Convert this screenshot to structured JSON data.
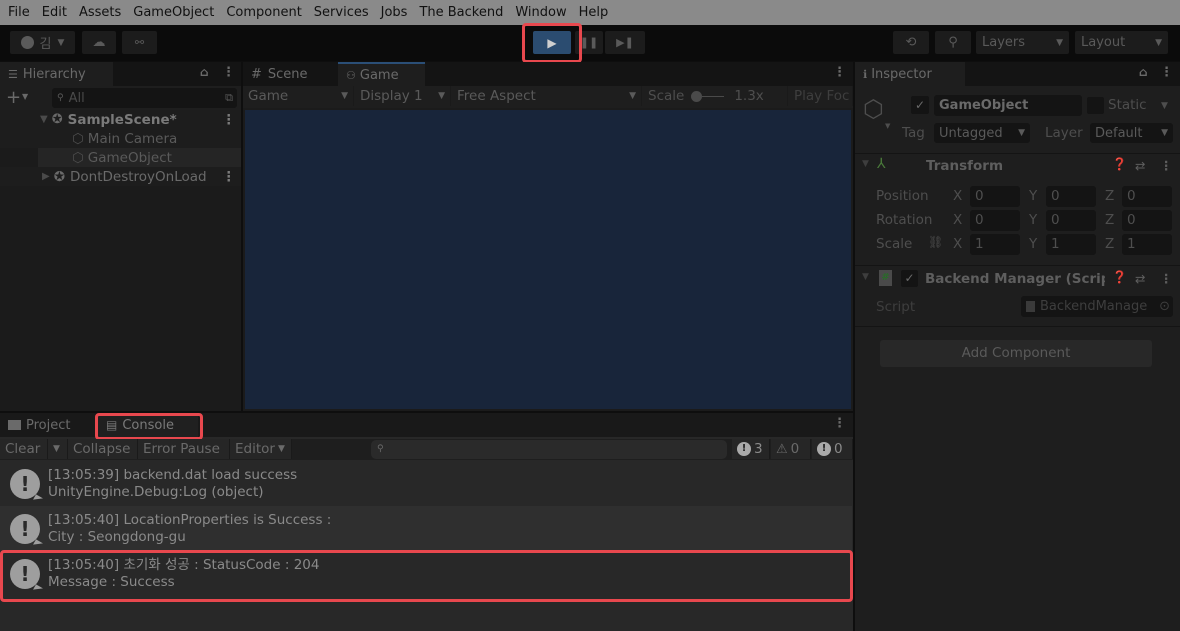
{
  "menubar": {
    "items": [
      "File",
      "Edit",
      "Assets",
      "GameObject",
      "Component",
      "Services",
      "Jobs",
      "The Backend",
      "Window",
      "Help"
    ]
  },
  "toolbar": {
    "account_label": "김",
    "layers_label": "Layers",
    "layout_label": "Layout",
    "play_state": "playing"
  },
  "hierarchy": {
    "tab_label": "Hierarchy",
    "search_placeholder": "All",
    "items": [
      {
        "label": "SampleScene*",
        "type": "scene",
        "expanded": true
      },
      {
        "label": "Main Camera",
        "type": "gameobject"
      },
      {
        "label": "GameObject",
        "type": "gameobject",
        "selected": true
      },
      {
        "label": "DontDestroyOnLoad",
        "type": "scene",
        "expanded": false
      }
    ]
  },
  "scene_view": {
    "tabs": [
      {
        "label": "Scene"
      },
      {
        "label": "Game",
        "active": true
      }
    ],
    "toolbar": {
      "view_mode": "Game",
      "display": "Display 1",
      "aspect": "Free Aspect",
      "scale_label": "Scale",
      "scale_value": "1.3x",
      "play_focused": "Play Foc"
    },
    "background_color": "#18253a"
  },
  "inspector": {
    "tab_label": "Inspector",
    "object_name": "GameObject",
    "active": true,
    "static_label": "Static",
    "tag_label": "Tag",
    "tag_value": "Untagged",
    "layer_label": "Layer",
    "layer_value": "Default",
    "transform": {
      "title": "Transform",
      "rows": [
        {
          "label": "Position",
          "x": "0",
          "y": "0",
          "z": "0"
        },
        {
          "label": "Rotation",
          "x": "0",
          "y": "0",
          "z": "0"
        },
        {
          "label": "Scale",
          "x": "1",
          "y": "1",
          "z": "1"
        }
      ],
      "axis": [
        "X",
        "Y",
        "Z"
      ]
    },
    "script_component": {
      "title": "Backend Manager (Script",
      "enabled": true,
      "script_label": "Script",
      "script_value": "BackendManage"
    },
    "add_component_label": "Add Component"
  },
  "console": {
    "tabs": [
      {
        "label": "Project"
      },
      {
        "label": "Console",
        "active": true
      }
    ],
    "toolbar": {
      "clear": "Clear",
      "collapse": "Collapse",
      "error_pause": "Error Pause",
      "editor": "Editor",
      "log_count": "3",
      "warning_count": "0",
      "error_count": "0"
    },
    "logs": [
      {
        "line1": "[13:05:39] backend.dat load success",
        "line2": "UnityEngine.Debug:Log (object)"
      },
      {
        "line1": "[13:05:40] LocationProperties is Success :",
        "line2": "City : Seongdong-gu"
      },
      {
        "line1": "[13:05:40] 초기화 성공 : StatusCode : 204",
        "line2": "Message : Success",
        "highlighted": true
      }
    ]
  }
}
